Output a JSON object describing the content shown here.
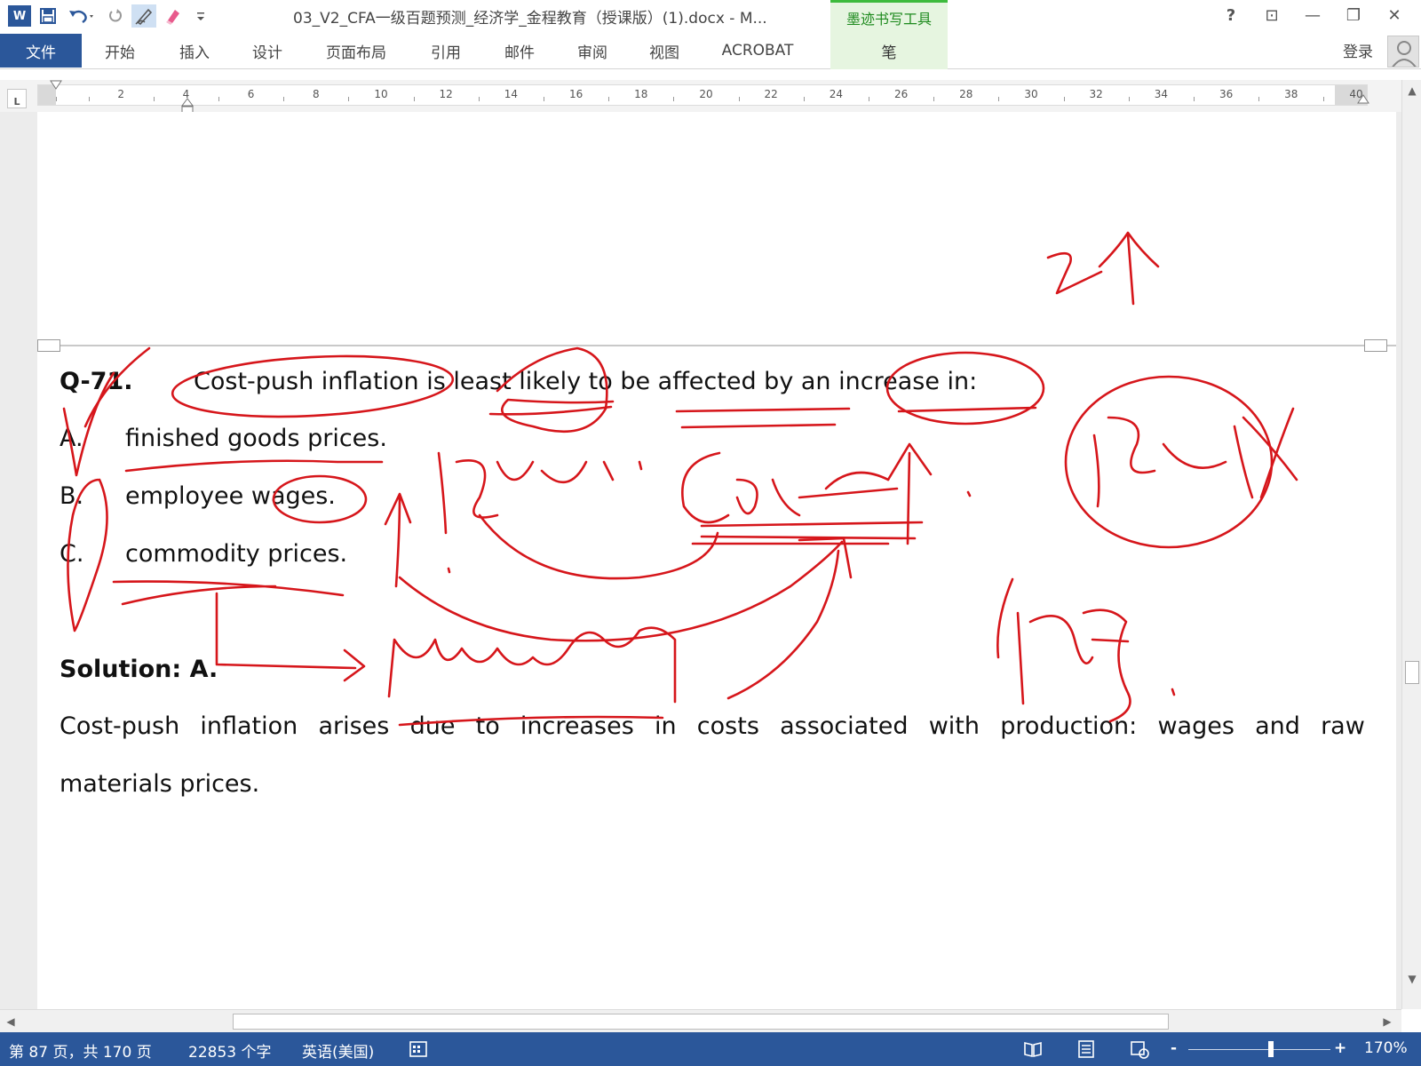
{
  "window": {
    "title": "03_V2_CFA一级百题预测_经济学_金程教育（授课版）(1).docx - M...",
    "contextual_group": "墨迹书写工具",
    "help": "?",
    "controls": [
      "?",
      "⊡",
      "—",
      "❐",
      "✕"
    ]
  },
  "quick_access": {
    "app_logo": "W",
    "icons": [
      "save-icon",
      "undo-icon",
      "redo-icon",
      "pen-icon",
      "eraser-icon",
      "customize-icon"
    ]
  },
  "ribbon": {
    "file_tab": "文件",
    "tabs": [
      "开始",
      "插入",
      "设计",
      "页面布局",
      "引用",
      "邮件",
      "审阅",
      "视图",
      "ACROBAT"
    ],
    "pen_tab": "笔",
    "login": "登录"
  },
  "ruler": {
    "corner": "L",
    "numbers": [
      "2",
      "4",
      "6",
      "8",
      "10",
      "12",
      "14",
      "16",
      "18",
      "20",
      "22",
      "24",
      "26",
      "28",
      "30",
      "32",
      "34",
      "36",
      "38",
      "40"
    ]
  },
  "document": {
    "question": {
      "label": "Q-71.",
      "stem": "Cost-push inflation is least likely to be affected by an increase in:",
      "options": [
        {
          "letter": "A.",
          "text": "finished goods prices."
        },
        {
          "letter": "B.",
          "text": "employee wages."
        },
        {
          "letter": "C.",
          "text": "commodity prices."
        }
      ]
    },
    "solution": {
      "heading": "Solution: A.",
      "line1": "Cost-push inflation arises due to increases in costs associated with production: wages and raw",
      "line2": "materials prices."
    }
  },
  "statusbar": {
    "page": "第 87 页，共 170 页",
    "words": "22853 个字",
    "language": "英语(美国)",
    "zoom": "170%",
    "zoom_minus": "-",
    "zoom_plus": "+"
  },
  "colors": {
    "accent": "#2b579a",
    "ink": "#d6161b",
    "ink_tab": "#e6f5e0",
    "ink_tab_text": "#1f8b1f"
  }
}
